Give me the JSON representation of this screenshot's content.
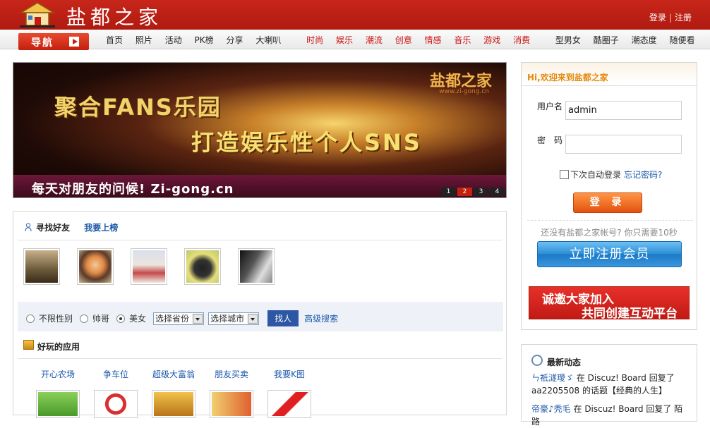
{
  "header": {
    "logo_text": "盐都之家",
    "login_link": "登录",
    "register_link": "注册",
    "accent_color": "#c01c12"
  },
  "nav": {
    "button_label": "导航",
    "items_black_1": [
      "首页",
      "照片",
      "活动",
      "PK榜",
      "分享",
      "大喇叭"
    ],
    "items_red": [
      "时尚",
      "娱乐",
      "潮流",
      "创意",
      "情感",
      "音乐",
      "游戏",
      "消费"
    ],
    "items_black_2": [
      "型男女",
      "酷圈子",
      "潮态度",
      "随便看"
    ]
  },
  "banner": {
    "line1": "聚合FANS乐园",
    "line2": "打造娱乐性个人SNS",
    "brand": "盐都之家",
    "site": "www.zi-gong.cn",
    "slogan": "每天对朋友的问候! Zi-gong.cn",
    "pages": [
      "1",
      "2",
      "3",
      "4"
    ],
    "active_page": "2"
  },
  "friends": {
    "title": "寻找好友",
    "rank_link": "我要上榜",
    "gender_options": [
      "不限性别",
      "帅哥",
      "美女"
    ],
    "selected_gender": "美女",
    "province_select": "选择省份",
    "city_select": "选择城市",
    "find_button": "找人",
    "advanced_search": "高级搜索"
  },
  "apps": {
    "title": "好玩的应用",
    "items": [
      "开心农场",
      "争车位",
      "超级大富翁",
      "朋友买卖",
      "我要K图"
    ]
  },
  "login": {
    "greeting": "Hi,欢迎来到盐都之家",
    "username_label": "用户名",
    "username_value": "admin",
    "password_label": "密　码",
    "password_value": "",
    "remember_label": "下次自动登录",
    "forgot_link": "忘记密码?",
    "login_button": "登 录",
    "hint": "还没有盐都之家帐号? 你只需要10秒",
    "register_button": "立即注册会员",
    "invite_line1": "诚邀大家加入",
    "invite_line2": "共同创建互动平台"
  },
  "news": {
    "title": "最新动态",
    "item1_user": "ㄣ祇澻璦ゞ",
    "item1_text": "在 Discuz! Board 回复了 aa2205508 的话题【经典的人生】",
    "item2_user": "帝豪♪秃毛",
    "item2_text": "在 Discuz! Board 回复了 陌路"
  }
}
